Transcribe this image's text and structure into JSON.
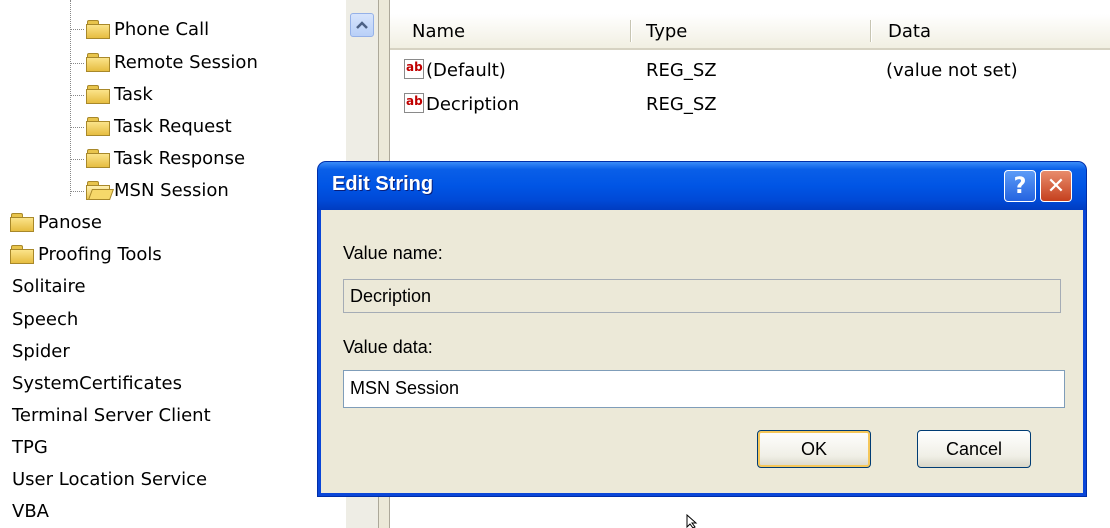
{
  "tree": {
    "children": [
      "Phone Call",
      "Remote Session",
      "Task",
      "Task Request",
      "Task Response",
      "MSN Session"
    ],
    "folders": [
      "Panose",
      "Proofing Tools"
    ],
    "keys": [
      "Solitaire",
      "Speech",
      "Spider",
      "SystemCertificates",
      "Terminal Server Client",
      "TPG",
      "User Location Service",
      "VBA"
    ]
  },
  "list": {
    "columns": [
      "Name",
      "Type",
      "Data"
    ],
    "rows": [
      {
        "name": "(Default)",
        "type": "REG_SZ",
        "data": "(value not set)"
      },
      {
        "name": "Decription",
        "type": "REG_SZ",
        "data": ""
      }
    ]
  },
  "dialog": {
    "title": "Edit String",
    "value_name_label": "Value name:",
    "value_name": "Decription",
    "value_data_label": "Value data:",
    "value_data": "MSN Session",
    "ok_label": "OK",
    "cancel_label": "Cancel",
    "help_glyph": "?",
    "close_glyph": "✕"
  },
  "icons": {
    "string_value": "ab"
  },
  "colors": {
    "titlebar": "#0055e5",
    "dialog_bg": "#ece9d8",
    "close_button": "#c5401e",
    "folder": "#e6bd41"
  }
}
